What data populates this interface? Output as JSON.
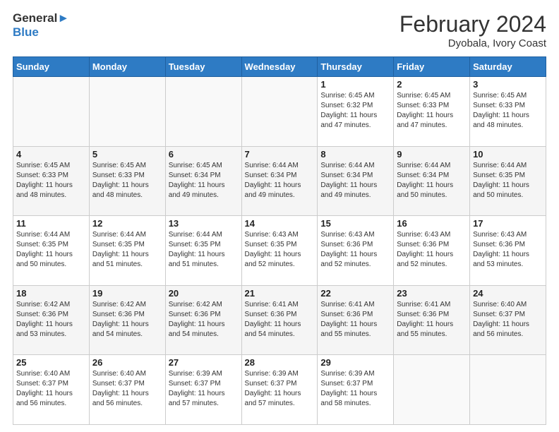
{
  "header": {
    "logo_line1": "General",
    "logo_line2": "Blue",
    "month_year": "February 2024",
    "location": "Dyobala, Ivory Coast"
  },
  "days_of_week": [
    "Sunday",
    "Monday",
    "Tuesday",
    "Wednesday",
    "Thursday",
    "Friday",
    "Saturday"
  ],
  "weeks": [
    [
      {
        "day": "",
        "info": ""
      },
      {
        "day": "",
        "info": ""
      },
      {
        "day": "",
        "info": ""
      },
      {
        "day": "",
        "info": ""
      },
      {
        "day": "1",
        "info": "Sunrise: 6:45 AM\nSunset: 6:32 PM\nDaylight: 11 hours and 47 minutes."
      },
      {
        "day": "2",
        "info": "Sunrise: 6:45 AM\nSunset: 6:33 PM\nDaylight: 11 hours and 47 minutes."
      },
      {
        "day": "3",
        "info": "Sunrise: 6:45 AM\nSunset: 6:33 PM\nDaylight: 11 hours and 48 minutes."
      }
    ],
    [
      {
        "day": "4",
        "info": "Sunrise: 6:45 AM\nSunset: 6:33 PM\nDaylight: 11 hours and 48 minutes."
      },
      {
        "day": "5",
        "info": "Sunrise: 6:45 AM\nSunset: 6:33 PM\nDaylight: 11 hours and 48 minutes."
      },
      {
        "day": "6",
        "info": "Sunrise: 6:45 AM\nSunset: 6:34 PM\nDaylight: 11 hours and 49 minutes."
      },
      {
        "day": "7",
        "info": "Sunrise: 6:44 AM\nSunset: 6:34 PM\nDaylight: 11 hours and 49 minutes."
      },
      {
        "day": "8",
        "info": "Sunrise: 6:44 AM\nSunset: 6:34 PM\nDaylight: 11 hours and 49 minutes."
      },
      {
        "day": "9",
        "info": "Sunrise: 6:44 AM\nSunset: 6:34 PM\nDaylight: 11 hours and 50 minutes."
      },
      {
        "day": "10",
        "info": "Sunrise: 6:44 AM\nSunset: 6:35 PM\nDaylight: 11 hours and 50 minutes."
      }
    ],
    [
      {
        "day": "11",
        "info": "Sunrise: 6:44 AM\nSunset: 6:35 PM\nDaylight: 11 hours and 50 minutes."
      },
      {
        "day": "12",
        "info": "Sunrise: 6:44 AM\nSunset: 6:35 PM\nDaylight: 11 hours and 51 minutes."
      },
      {
        "day": "13",
        "info": "Sunrise: 6:44 AM\nSunset: 6:35 PM\nDaylight: 11 hours and 51 minutes."
      },
      {
        "day": "14",
        "info": "Sunrise: 6:43 AM\nSunset: 6:35 PM\nDaylight: 11 hours and 52 minutes."
      },
      {
        "day": "15",
        "info": "Sunrise: 6:43 AM\nSunset: 6:36 PM\nDaylight: 11 hours and 52 minutes."
      },
      {
        "day": "16",
        "info": "Sunrise: 6:43 AM\nSunset: 6:36 PM\nDaylight: 11 hours and 52 minutes."
      },
      {
        "day": "17",
        "info": "Sunrise: 6:43 AM\nSunset: 6:36 PM\nDaylight: 11 hours and 53 minutes."
      }
    ],
    [
      {
        "day": "18",
        "info": "Sunrise: 6:42 AM\nSunset: 6:36 PM\nDaylight: 11 hours and 53 minutes."
      },
      {
        "day": "19",
        "info": "Sunrise: 6:42 AM\nSunset: 6:36 PM\nDaylight: 11 hours and 54 minutes."
      },
      {
        "day": "20",
        "info": "Sunrise: 6:42 AM\nSunset: 6:36 PM\nDaylight: 11 hours and 54 minutes."
      },
      {
        "day": "21",
        "info": "Sunrise: 6:41 AM\nSunset: 6:36 PM\nDaylight: 11 hours and 54 minutes."
      },
      {
        "day": "22",
        "info": "Sunrise: 6:41 AM\nSunset: 6:36 PM\nDaylight: 11 hours and 55 minutes."
      },
      {
        "day": "23",
        "info": "Sunrise: 6:41 AM\nSunset: 6:36 PM\nDaylight: 11 hours and 55 minutes."
      },
      {
        "day": "24",
        "info": "Sunrise: 6:40 AM\nSunset: 6:37 PM\nDaylight: 11 hours and 56 minutes."
      }
    ],
    [
      {
        "day": "25",
        "info": "Sunrise: 6:40 AM\nSunset: 6:37 PM\nDaylight: 11 hours and 56 minutes."
      },
      {
        "day": "26",
        "info": "Sunrise: 6:40 AM\nSunset: 6:37 PM\nDaylight: 11 hours and 56 minutes."
      },
      {
        "day": "27",
        "info": "Sunrise: 6:39 AM\nSunset: 6:37 PM\nDaylight: 11 hours and 57 minutes."
      },
      {
        "day": "28",
        "info": "Sunrise: 6:39 AM\nSunset: 6:37 PM\nDaylight: 11 hours and 57 minutes."
      },
      {
        "day": "29",
        "info": "Sunrise: 6:39 AM\nSunset: 6:37 PM\nDaylight: 11 hours and 58 minutes."
      },
      {
        "day": "",
        "info": ""
      },
      {
        "day": "",
        "info": ""
      }
    ]
  ]
}
